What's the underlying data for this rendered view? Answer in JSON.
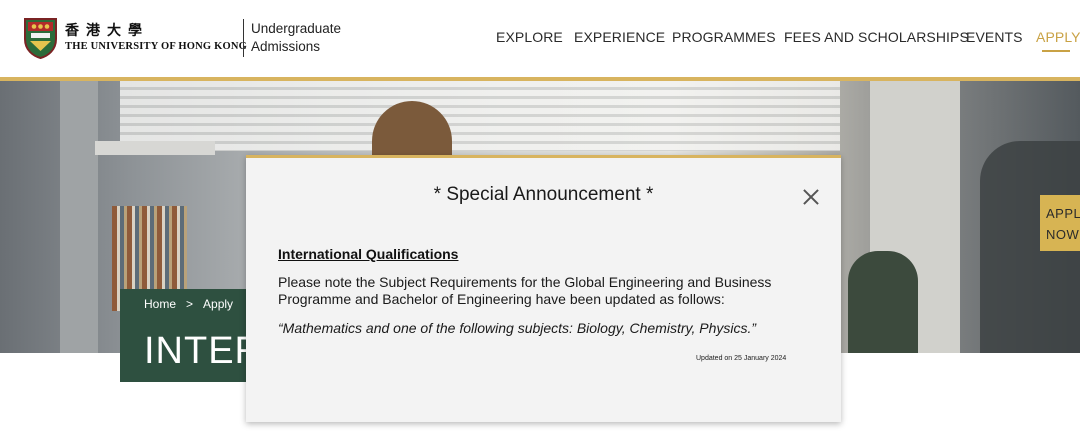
{
  "header": {
    "logo": {
      "zh": "香港大學",
      "en": "THE UNIVERSITY OF HONG KONG",
      "icon": "hku-crest-icon"
    },
    "site_title": "Undergraduate Admissions",
    "nav": [
      {
        "label": "EXPLORE"
      },
      {
        "label": "EXPERIENCE"
      },
      {
        "label": "PROGRAMMES"
      },
      {
        "label": "FEES AND SCHOLARSHIPS"
      },
      {
        "label": "EVENTS"
      },
      {
        "label": "APPLY",
        "active": true
      }
    ]
  },
  "hero": {
    "apply_now": [
      "APPLY",
      "NOW"
    ],
    "breadcrumb": [
      "Home",
      "Apply"
    ],
    "breadcrumb_separator": ">",
    "page_heading": "INTER"
  },
  "modal": {
    "title": "* Special Announcement *",
    "close_icon": "close-icon",
    "subheading": "International Qualifications",
    "body": "Please note the Subject Requirements for the Global Engineering and Business Programme and Bachelor of Engineering have been updated as follows:",
    "quote": "“Mathematics and one of the following subjects: Biology, Chemistry, Physics.”",
    "updated": "Updated on 25 January 2024"
  },
  "colors": {
    "gold": "#d8b45f",
    "green": "#2e5040",
    "modal_bg": "#f3f3f3"
  }
}
